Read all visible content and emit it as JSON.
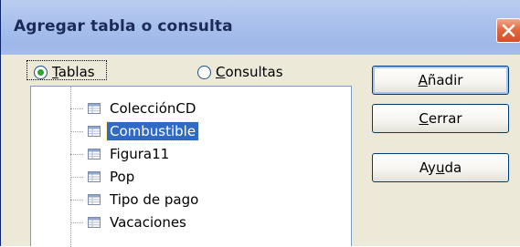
{
  "window": {
    "title": "Agregar tabla o consulta",
    "close_icon": "close-x-icon"
  },
  "source": {
    "tablas": {
      "prefix": "",
      "hotkey": "T",
      "suffix": "ablas",
      "selected": true
    },
    "consultas": {
      "prefix": "",
      "hotkey": "C",
      "suffix": "onsultas",
      "selected": false
    }
  },
  "list": {
    "items": [
      {
        "label": "ColecciónCD",
        "icon": "table-icon",
        "selected": false
      },
      {
        "label": "Combustible",
        "icon": "table-icon",
        "selected": true
      },
      {
        "label": "Figura11",
        "icon": "table-icon",
        "selected": false
      },
      {
        "label": "Pop",
        "icon": "table-icon",
        "selected": false
      },
      {
        "label": "Tipo de pago",
        "icon": "table-icon",
        "selected": false
      },
      {
        "label": "Vacaciones",
        "icon": "table-icon",
        "selected": false
      }
    ]
  },
  "buttons": {
    "anadir": {
      "prefix": "",
      "hotkey": "A",
      "suffix": "ñadir"
    },
    "cerrar": {
      "prefix": "",
      "hotkey": "C",
      "suffix": "errar"
    },
    "ayuda": {
      "prefix": "Ay",
      "hotkey": "u",
      "suffix": "da"
    }
  },
  "colors": {
    "selection": "#316ac5",
    "titlebar": "#a9c0ec",
    "close_button": "#e2693f",
    "radio_dot": "#2da42d"
  }
}
